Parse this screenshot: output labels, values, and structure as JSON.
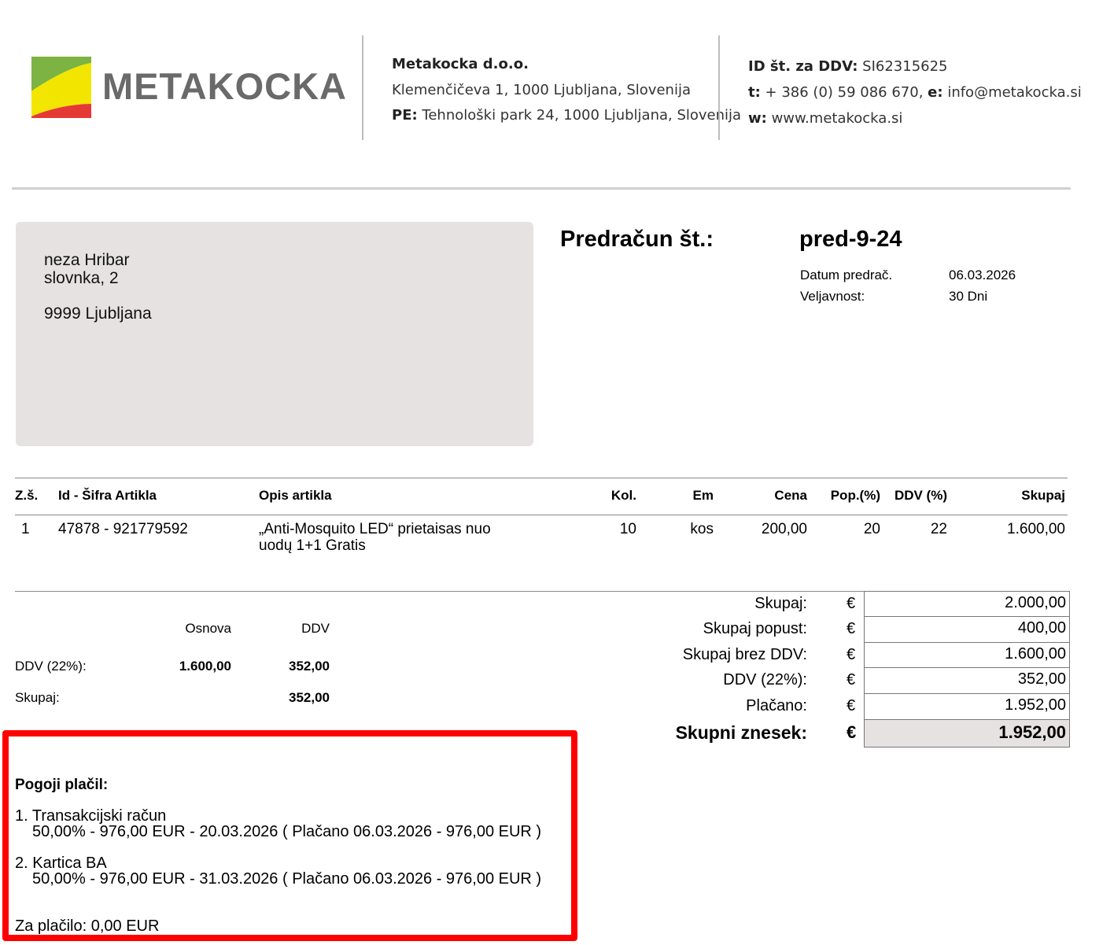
{
  "header": {
    "logo_text": "METAKOCKA",
    "company_name": "Metakocka d.o.o.",
    "company_address": "Klemenčičeva 1, 1000 Ljubljana, Slovenija",
    "pe_label": "PE:",
    "pe_address": "Tehnološki park 24, 1000 Ljubljana, Slovenija",
    "vat_id_label": "ID št. za DDV:",
    "vat_id_value": "SI62315625",
    "phone_label": "t:",
    "phone_value": "+ 386 (0) 59 086 670,",
    "email_label": "e:",
    "email_value": "info@metakocka.si",
    "web_label": "w:",
    "web_value": "www.metakocka.si",
    "colors": {
      "logo_green": "#7cb342",
      "logo_yellow": "#f2e500",
      "logo_red": "#e53935",
      "logo_text": "#6a6a6a"
    }
  },
  "recipient": {
    "line1": "neza Hribar",
    "line2": "slovnka, 2",
    "line3": "9999 Ljubljana"
  },
  "document": {
    "title": "Predračun št.:",
    "number": "pred-9-24",
    "date_label": "Datum predrač.",
    "date_value": "06.03.2026",
    "validity_label": "Veljavnost:",
    "validity_value": "30 Dni"
  },
  "items_table": {
    "headers": {
      "no": "Z.š.",
      "id": "Id - Šifra Artikla",
      "desc": "Opis artikla",
      "qty": "Kol.",
      "unit": "Em",
      "price": "Cena",
      "discount": "Pop.(%)",
      "vat": "DDV (%)",
      "total": "Skupaj"
    },
    "rows": [
      {
        "no": "1",
        "id": "47878 - 921779592",
        "desc_line1": "„Anti-Mosquito LED“ prietaisas nuo",
        "desc_line2": "uodų 1+1 Gratis",
        "qty": "10",
        "unit": "kos",
        "price": "200,00",
        "discount": "20",
        "vat": "22",
        "total": "1.600,00"
      }
    ]
  },
  "vat_summary": {
    "base_header": "Osnova",
    "vat_header": "DDV",
    "rate_label": "DDV (22%):",
    "rate_base": "1.600,00",
    "rate_vat": "352,00",
    "total_label": "Skupaj:",
    "total_vat": "352,00"
  },
  "totals": {
    "currency": "€",
    "rows": [
      {
        "label": "Skupaj:",
        "value": "2.000,00"
      },
      {
        "label": "Skupaj popust:",
        "value": "400,00"
      },
      {
        "label": "Skupaj brez DDV:",
        "value": "1.600,00"
      },
      {
        "label": "DDV (22%):",
        "value": "352,00"
      },
      {
        "label": "Plačano:",
        "value": "1.952,00"
      }
    ],
    "grand_label": "Skupni znesek:",
    "grand_value": "1.952,00"
  },
  "payment": {
    "title": "Pogoji plačil:",
    "method1": "1. Transakcijski račun",
    "method1_detail": "50,00% - 976,00 EUR - 20.03.2026 ( Plačano 06.03.2026 - 976,00 EUR )",
    "method2": "2. Kartica BA",
    "method2_detail": "50,00% - 976,00 EUR - 31.03.2026 ( Plačano 06.03.2026 - 976,00 EUR )",
    "due": "Za plačilo: 0,00 EUR",
    "highlight_color": "#ff0000"
  }
}
